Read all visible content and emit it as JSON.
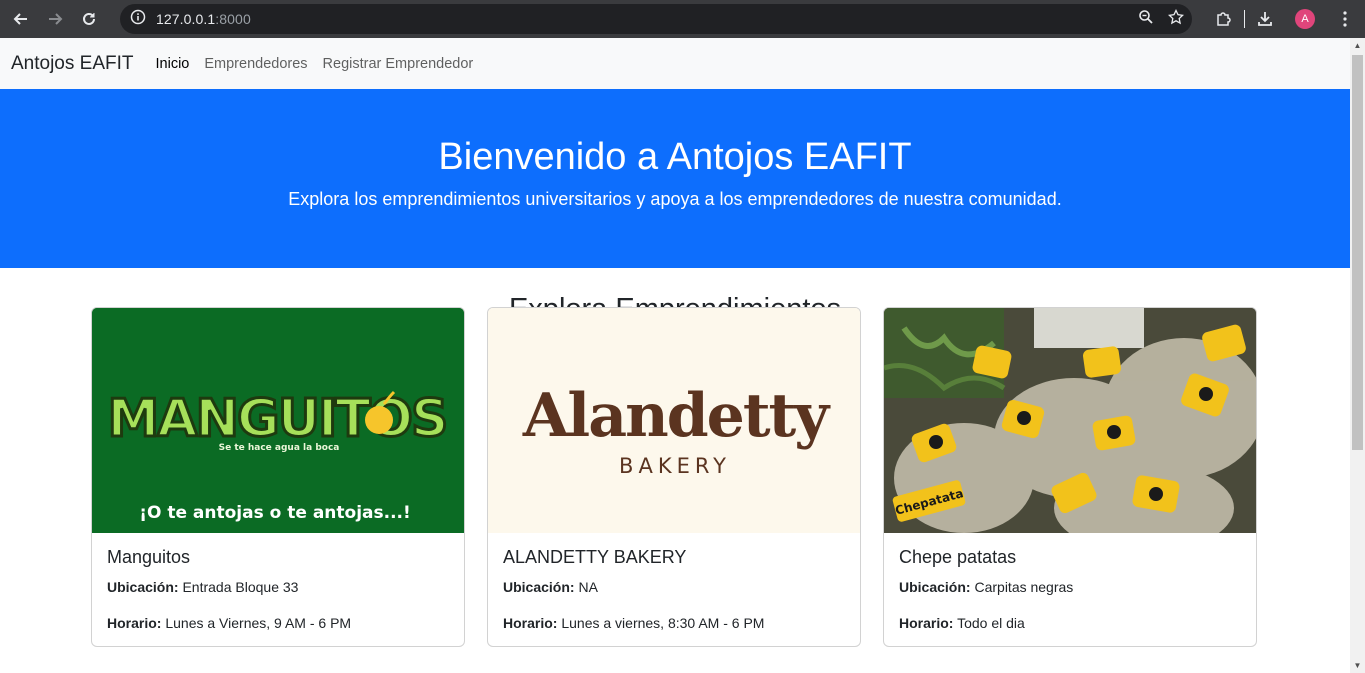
{
  "browser": {
    "url_host": "127.0.0.1",
    "url_port": ":8000",
    "avatar_letter": "A"
  },
  "navbar": {
    "brand": "Antojos EAFIT",
    "links": [
      {
        "label": "Inicio",
        "active": true
      },
      {
        "label": "Emprendedores",
        "active": false
      },
      {
        "label": "Registrar Emprendedor",
        "active": false
      }
    ]
  },
  "hero": {
    "title": "Bienvenido a Antojos EAFIT",
    "subtitle": "Explora los emprendimientos universitarios y apoya a los emprendedores de nuestra comunidad."
  },
  "section": {
    "title": "Explora Emprendimientos"
  },
  "cards": [
    {
      "name": "Manguitos",
      "location_label": "Ubicación:",
      "location": "Entrada Bloque 33",
      "hours_label": "Horario:",
      "hours": "Lunes a Viernes, 9 AM - 6 PM",
      "image": {
        "logo_text": "MANGUITOS",
        "tagline": "Se te hace agua la boca",
        "slogan": "¡O te antojas o te antojas...!"
      }
    },
    {
      "name": "ALANDETTY BAKERY",
      "location_label": "Ubicación:",
      "location": "NA",
      "hours_label": "Horario:",
      "hours": "Lunes a viernes, 8:30 AM - 6 PM",
      "image": {
        "logo_text": "Alandetty",
        "sub_text": "BAKERY"
      }
    },
    {
      "name": "Chepe patatas",
      "location_label": "Ubicación:",
      "location": "Carpitas negras",
      "hours_label": "Horario:",
      "hours": "Todo el dia",
      "image": {
        "logo_text": "Chepatata"
      }
    }
  ],
  "colors": {
    "hero_bg": "#0d6efd",
    "navbar_bg": "#f8f9fa",
    "manguitos_bg": "#0b6b24",
    "alandetty_bg": "#fdf8ec",
    "alandetty_text": "#5b3420"
  }
}
